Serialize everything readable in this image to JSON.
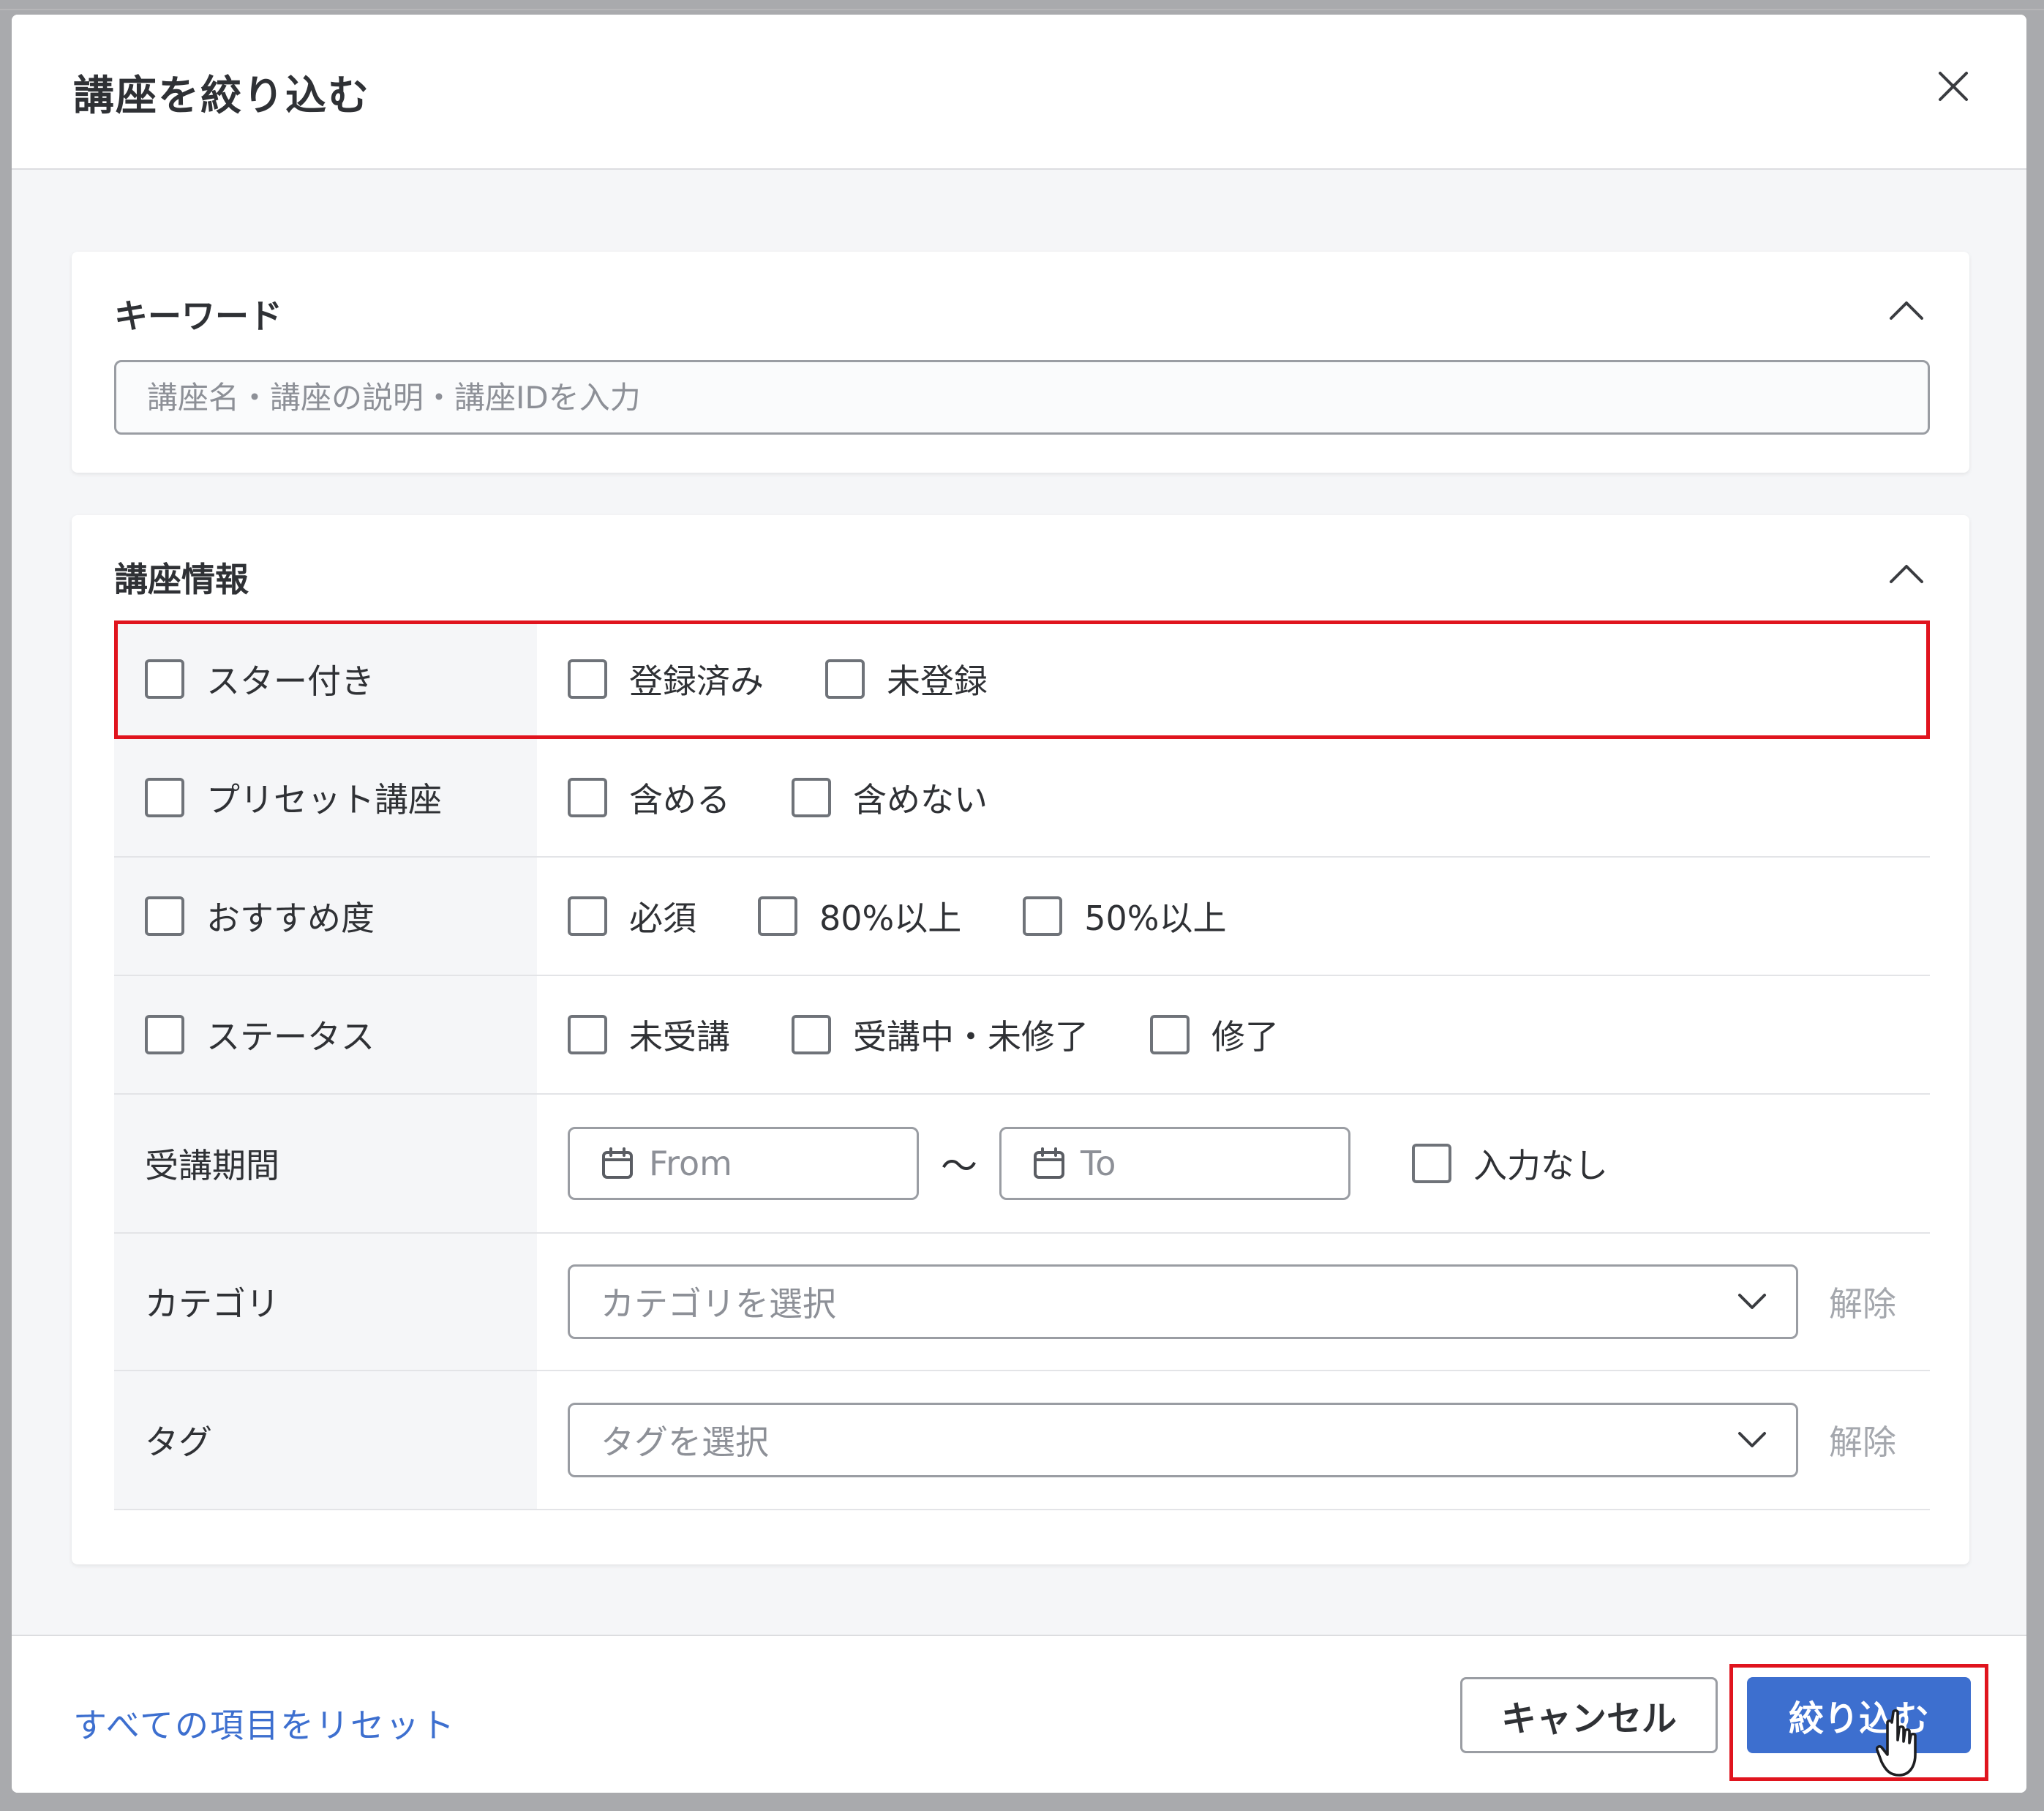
{
  "dialog": {
    "title": "講座を絞り込む",
    "close_icon": "close-icon"
  },
  "keyword_section": {
    "title": "キーワード",
    "placeholder": "講座名・講座の説明・講座IDを入力",
    "value": ""
  },
  "course_info_section": {
    "title": "講座情報",
    "rows": [
      {
        "label": "スター付き",
        "checked": false,
        "options": [
          {
            "label": "登録済み",
            "checked": false
          },
          {
            "label": "未登録",
            "checked": false
          }
        ]
      },
      {
        "label": "プリセット講座",
        "checked": false,
        "options": [
          {
            "label": "含める",
            "checked": false
          },
          {
            "label": "含めない",
            "checked": false
          }
        ]
      },
      {
        "label": "おすすめ度",
        "checked": false,
        "options": [
          {
            "label": "必須",
            "checked": false
          },
          {
            "label": "80%以上",
            "checked": false
          },
          {
            "label": "50%以上",
            "checked": false
          }
        ]
      },
      {
        "label": "ステータス",
        "checked": false,
        "options": [
          {
            "label": "未受講",
            "checked": false
          },
          {
            "label": "受講中・未修了",
            "checked": false
          },
          {
            "label": "修了",
            "checked": false
          }
        ]
      }
    ],
    "period": {
      "label": "受講期間",
      "from_placeholder": "From",
      "separator": "〜",
      "to_placeholder": "To",
      "no_input_label": "入力なし"
    },
    "category": {
      "label": "カテゴリ",
      "placeholder": "カテゴリを選択",
      "clear": "解除"
    },
    "tag": {
      "label": "タグ",
      "placeholder": "タグを選択",
      "clear": "解除"
    }
  },
  "footer": {
    "reset": "すべての項目をリセット",
    "cancel": "キャンセル",
    "apply": "絞り込む"
  },
  "colors": {
    "accent": "#3d6fcf",
    "highlight": "#e0141e",
    "label_bg": "#f5f6f8"
  }
}
